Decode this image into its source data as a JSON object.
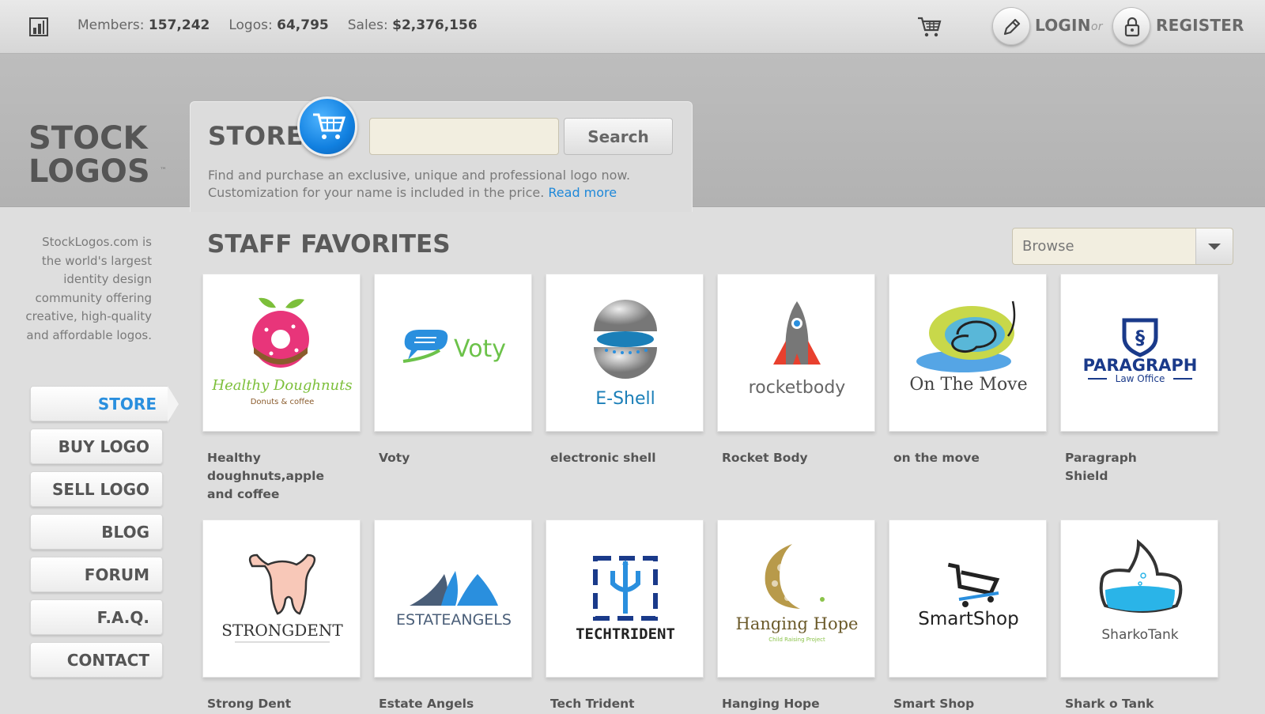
{
  "topbar": {
    "stats": [
      {
        "label": "Members:",
        "value": "157,242"
      },
      {
        "label": "Logos:",
        "value": "64,795"
      },
      {
        "label": "Sales:",
        "value": "$2,376,156"
      }
    ],
    "login": "LOGIN",
    "or": "or",
    "register": "REGISTER"
  },
  "brand": {
    "line1": "STOCK",
    "line2": "LOGOS"
  },
  "store": {
    "title": "STORE",
    "search_placeholder": "",
    "search_button": "Search",
    "desc": "Find and purchase an exclusive, unique and professional logo now. Customization for your name is included in the price.",
    "read_more": "Read more"
  },
  "about": "StockLogos.com is the world's largest identity design community offering creative, high-quality and affordable logos.",
  "nav": [
    "STORE",
    "BUY LOGO",
    "SELL LOGO",
    "BLOG",
    "FORUM",
    "F.A.Q.",
    "CONTACT"
  ],
  "section_title": "STAFF FAVORITES",
  "browse": "Browse",
  "logos": [
    {
      "caption": "Healthy doughnuts,apple and coffee",
      "brand": "Healthy Doughnuts",
      "tag": "Donuts & coffee"
    },
    {
      "caption": "Voty",
      "brand": "Voty",
      "tag": ""
    },
    {
      "caption": "electronic shell",
      "brand": "E-Shell",
      "tag": ""
    },
    {
      "caption": "Rocket Body",
      "brand": "rocketbody",
      "tag": ""
    },
    {
      "caption": "on the move",
      "brand": "On The Move",
      "tag": ""
    },
    {
      "caption": "Paragraph Shield",
      "brand": "PARAGRAPH",
      "tag": "Law Office"
    },
    {
      "caption": "Strong Dent",
      "brand": "STRONGDENT",
      "tag": ""
    },
    {
      "caption": "Estate Angels",
      "brand": "ESTATEANGELS",
      "tag": ""
    },
    {
      "caption": "Tech Trident",
      "brand": "TECHTRIDENT",
      "tag": ""
    },
    {
      "caption": "Hanging Hope",
      "brand": "Hanging Hope",
      "tag": "Child Raising Project"
    },
    {
      "caption": "Smart Shop",
      "brand": "SmartShop",
      "tag": ""
    },
    {
      "caption": "Shark o Tank",
      "brand": "SharkoTank",
      "tag": ""
    }
  ],
  "colors": {
    "accent_blue": "#2a8fde",
    "page_bg": "#dedede"
  }
}
